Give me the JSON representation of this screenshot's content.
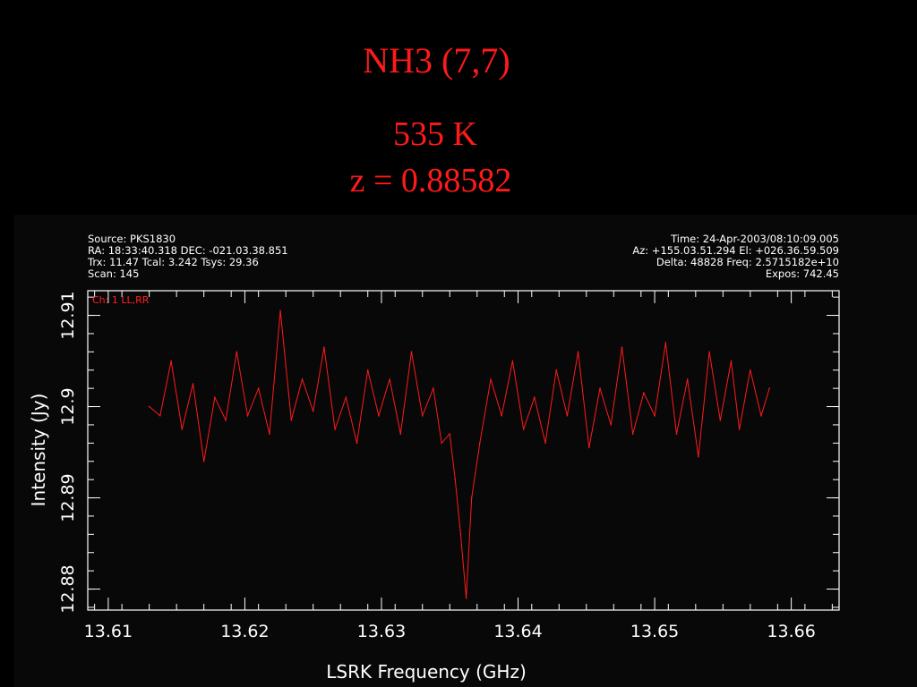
{
  "slide": {
    "title": "NH3 (7,7)",
    "subtitle_temp": "535 K",
    "subtitle_z": "z = 0.88582"
  },
  "header": {
    "left": [
      "Source: PKS1830",
      "RA: 18:33:40.318 DEC: -021.03.38.851",
      "Trx: 11.47 Tcal: 3.242 Tsys: 29.36",
      "Scan: 145"
    ],
    "right": [
      "Time: 24-Apr-2003/08:10:09.005",
      "Az: +155.03.51.294 El: +026.36.59.509",
      "Delta: 48828 Freq: 2.5715182e+10",
      "Expos: 742.45"
    ]
  },
  "chart_data": {
    "type": "line",
    "xlabel": "LSRK Frequency (GHz)",
    "ylabel": "Intensity (Jy)",
    "legend": "Ch: 1 LL,RR",
    "line_color": "#ff1a1a",
    "xlim": [
      13.6085,
      13.6635
    ],
    "ylim": [
      12.8777,
      12.9127
    ],
    "xticks": [
      13.61,
      13.62,
      13.63,
      13.64,
      13.65,
      13.66
    ],
    "xtick_labels": [
      "13.61",
      "13.62",
      "13.63",
      "13.64",
      "13.65",
      "13.66"
    ],
    "yticks": [
      12.88,
      12.89,
      12.9,
      12.91
    ],
    "ytick_labels": [
      "12.88",
      "12.89",
      "12.9",
      "12.91"
    ],
    "x": [
      13.613,
      13.6138,
      13.6146,
      13.6154,
      13.6162,
      13.617,
      13.6178,
      13.6186,
      13.6194,
      13.6202,
      13.621,
      13.6218,
      13.6226,
      13.6234,
      13.6242,
      13.625,
      13.6258,
      13.6266,
      13.6274,
      13.6282,
      13.629,
      13.6298,
      13.6306,
      13.6314,
      13.6322,
      13.633,
      13.6338,
      13.6344,
      13.635,
      13.6354,
      13.6358,
      13.6362,
      13.6366,
      13.6372,
      13.638,
      13.6388,
      13.6396,
      13.6404,
      13.6412,
      13.642,
      13.6428,
      13.6436,
      13.6444,
      13.6452,
      13.646,
      13.6468,
      13.6476,
      13.6484,
      13.6492,
      13.65,
      13.6508,
      13.6516,
      13.6524,
      13.6532,
      13.654,
      13.6548,
      13.6556,
      13.6562,
      13.657,
      13.6578,
      13.6584
    ],
    "y": [
      12.9,
      12.899,
      12.905,
      12.8975,
      12.9025,
      12.894,
      12.901,
      12.8985,
      12.906,
      12.899,
      12.902,
      12.897,
      12.9105,
      12.8985,
      12.903,
      12.8995,
      12.9065,
      12.8975,
      12.901,
      12.896,
      12.904,
      12.899,
      12.903,
      12.897,
      12.906,
      12.899,
      12.902,
      12.896,
      12.897,
      12.892,
      12.886,
      12.879,
      12.89,
      12.896,
      12.903,
      12.899,
      12.905,
      12.8975,
      12.901,
      12.896,
      12.904,
      12.899,
      12.906,
      12.8955,
      12.902,
      12.898,
      12.9065,
      12.897,
      12.9015,
      12.899,
      12.907,
      12.897,
      12.903,
      12.8945,
      12.906,
      12.8985,
      12.905,
      12.8975,
      12.904,
      12.899,
      12.902
    ]
  }
}
